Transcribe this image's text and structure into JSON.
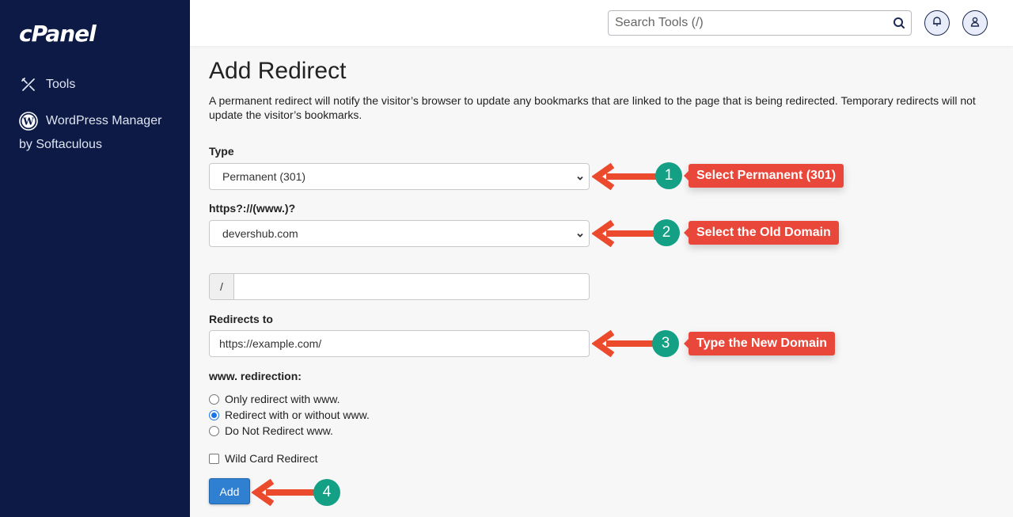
{
  "sidebar": {
    "logo": "cPanel",
    "items": [
      {
        "label": "Tools",
        "icon": "tools-icon"
      },
      {
        "label": "WordPress Manager",
        "sublabel": "by Softaculous",
        "icon": "wordpress-icon"
      }
    ]
  },
  "topbar": {
    "search_placeholder": "Search Tools (/)",
    "search_icon": "search-icon",
    "notifications_icon": "bell-icon",
    "user_icon": "user-icon"
  },
  "page": {
    "title": "Add Redirect",
    "description": "A permanent redirect will notify the visitor’s browser to update any bookmarks that are linked to the page that is being redirected. Temporary redirects will not update the visitor’s bookmarks."
  },
  "form": {
    "type_label": "Type",
    "type_value": "Permanent (301)",
    "domain_label": "https?://(www.)?",
    "domain_value": "devershub.com",
    "path_prefix": "/",
    "path_value": "",
    "redirects_to_label": "Redirects to",
    "redirects_to_value": "https://example.com/",
    "www_label": "www. redirection:",
    "www_options": [
      {
        "label": "Only redirect with www.",
        "selected": false
      },
      {
        "label": "Redirect with or without www.",
        "selected": true
      },
      {
        "label": "Do Not Redirect www.",
        "selected": false
      }
    ],
    "wildcard_label": "Wild Card Redirect",
    "wildcard_checked": false,
    "add_button": "Add"
  },
  "annotations": [
    {
      "step": "1",
      "text": "Select Permanent (301)"
    },
    {
      "step": "2",
      "text": "Select the Old Domain"
    },
    {
      "step": "3",
      "text": "Type the New Domain"
    },
    {
      "step": "4",
      "text": ""
    }
  ],
  "colors": {
    "sidebar_bg": "#0c1a45",
    "primary_button": "#2f80d1",
    "annotation_red": "#e8473a",
    "annotation_teal": "#14a085"
  }
}
